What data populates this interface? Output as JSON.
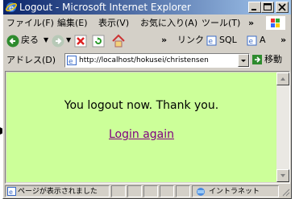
{
  "window": {
    "title": "Logout - Microsoft Internet Explorer",
    "controls": {
      "minimize_icon": "minimize-icon",
      "maximize_icon": "maximize-icon",
      "close_icon": "close-icon"
    }
  },
  "menubar": {
    "items": [
      "ファイル(F)",
      "編集(E)",
      "表示(V)",
      "お気に入り(A)",
      "ツール(T)"
    ],
    "overflow": "»"
  },
  "toolbar": {
    "back_label": "戻る",
    "overflow": "»",
    "links_label": "リンク",
    "sql_label": "SQL",
    "a_label": "A",
    "overflow2": "»"
  },
  "address": {
    "label": "アドレス(D)",
    "url": "http://localhost/hokusei/christensen",
    "go_label": "移動"
  },
  "page": {
    "message": "You logout now. Thank you.",
    "link_text": "Login again",
    "background": "#ccff99",
    "link_color": "#800080"
  },
  "status": {
    "text": "ページが表示されました",
    "zone": "イントラネット"
  }
}
